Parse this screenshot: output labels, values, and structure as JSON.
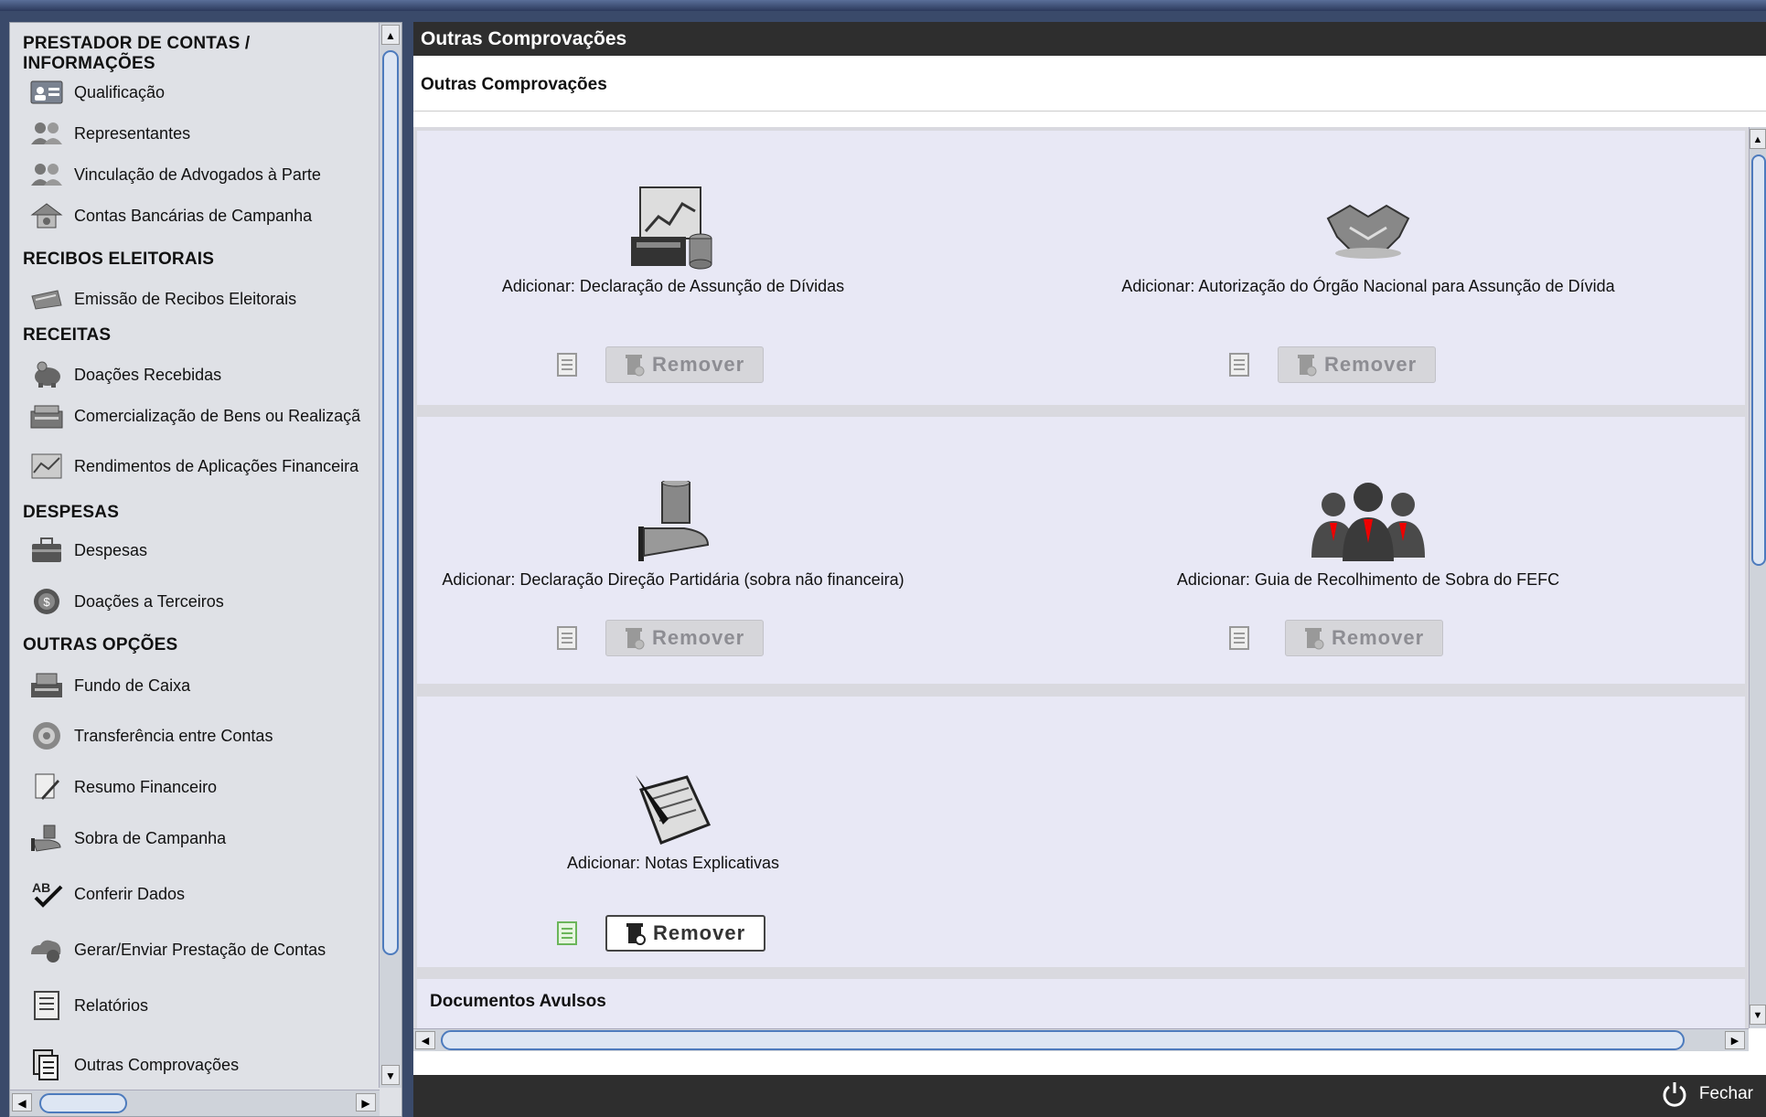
{
  "sidebar": {
    "sections": [
      {
        "title": "PRESTADOR DE CONTAS / INFORMAÇÕES"
      },
      {
        "title": "RECIBOS ELEITORAIS"
      },
      {
        "title": "RECEITAS"
      },
      {
        "title": "DESPESAS"
      },
      {
        "title": "OUTRAS OPÇÕES"
      }
    ],
    "items": [
      {
        "label": "Qualificação",
        "icon": "id-card-icon"
      },
      {
        "label": "Representantes",
        "icon": "people-icon"
      },
      {
        "label": "Vinculação de Advogados à Parte",
        "icon": "people-icon"
      },
      {
        "label": "Contas Bancárias de Campanha",
        "icon": "bank-icon"
      },
      {
        "label": "Emissão de Recibos Eleitorais",
        "icon": "receipt-icon"
      },
      {
        "label": "Doações Recebidas",
        "icon": "piggy-bank-icon"
      },
      {
        "label": "Comercialização de Bens ou Realizaçã",
        "icon": "register-icon"
      },
      {
        "label": "Rendimentos de Aplicações Financeira",
        "icon": "chart-icon"
      },
      {
        "label": "Despesas",
        "icon": "briefcase-icon"
      },
      {
        "label": "Doações a Terceiros",
        "icon": "coin-icon"
      },
      {
        "label": "Fundo de Caixa",
        "icon": "cash-register-icon"
      },
      {
        "label": "Transferência entre Contas",
        "icon": "transfer-icon"
      },
      {
        "label": "Resumo Financeiro",
        "icon": "document-pen-icon"
      },
      {
        "label": "Sobra de Campanha",
        "icon": "hand-coins-icon"
      },
      {
        "label": "Conferir Dados",
        "icon": "spellcheck-icon"
      },
      {
        "label": "Gerar/Enviar Prestação de Contas",
        "icon": "cloud-send-icon"
      },
      {
        "label": "Relatórios",
        "icon": "report-icon"
      },
      {
        "label": "Outras Comprovações",
        "icon": "documents-icon"
      }
    ]
  },
  "main": {
    "header_title": "Outras Comprovações",
    "subtitle": "Outras Comprovações",
    "cards": [
      {
        "label": "Adicionar: Declaração de Assunção de Dívidas",
        "icon": "finance-chart-icon",
        "remove_label": "Remover",
        "remove_enabled": false
      },
      {
        "label": "Adicionar: Autorização do Órgão Nacional para Assunção de Dívida",
        "icon": "handshake-icon",
        "remove_label": "Remover",
        "remove_enabled": false
      },
      {
        "label": "Adicionar: Declaração Direção Partidária (sobra não financeira)",
        "icon": "hand-coins-icon",
        "remove_label": "Remover",
        "remove_enabled": false
      },
      {
        "label": "Adicionar: Guia de Recolhimento de Sobra do FEFC",
        "icon": "business-people-icon",
        "remove_label": "Remover",
        "remove_enabled": false
      },
      {
        "label": "Adicionar: Notas Explicativas",
        "icon": "notepad-pen-icon",
        "remove_label": "Remover",
        "remove_enabled": true
      }
    ],
    "documentos_avulsos": "Documentos Avulsos"
  },
  "footer": {
    "close_label": "Fechar"
  },
  "colors": {
    "header_bg": "#2e2e2e",
    "panel_bg": "#e8e8f5",
    "sidebar_bg": "#dfe1e6",
    "scroll_accent": "#4d7bbd"
  }
}
